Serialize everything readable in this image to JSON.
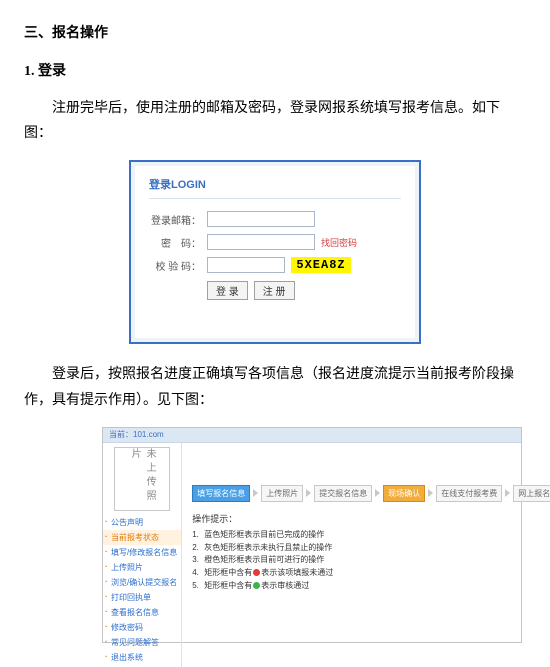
{
  "doc": {
    "heading_section": "三、报名操作",
    "heading_sub": "1. 登录",
    "para1": "注册完毕后，使用注册的邮箱及密码，登录网报系统填写报考信息。如下图：",
    "para2": "登录后，按照报名进度正确填写各项信息（报名进度流提示当前报考阶段操作，具有提示作用）。见下图："
  },
  "login": {
    "title": "登录LOGIN",
    "label_email": "登录邮箱：",
    "label_pwd": "密　码：",
    "label_captcha": "校 验 码：",
    "find_pwd": "找回密码",
    "captcha": "5XEA8Z",
    "btn_login": "登 录",
    "btn_reg": "注 册"
  },
  "progress": {
    "topbar": "当前：101.com",
    "photo_slot": "未上传照片",
    "side_items": [
      {
        "label": "公告声明",
        "cls": "blue"
      },
      {
        "label": "当前报考状态",
        "cls": "orange"
      },
      {
        "label": "填写/修改报名信息",
        "cls": "blue"
      },
      {
        "label": "上传照片",
        "cls": "blue"
      },
      {
        "label": "浏览/确认提交报名",
        "cls": "blue"
      },
      {
        "label": "打印回执单",
        "cls": "blue"
      },
      {
        "label": "查看报名信息",
        "cls": "blue"
      },
      {
        "label": "修改密码",
        "cls": "blue"
      },
      {
        "label": "常见问题解答",
        "cls": "blue"
      },
      {
        "label": "退出系统",
        "cls": "blue"
      }
    ],
    "flow_steps": [
      {
        "label": "填写报名信息",
        "state": "done"
      },
      {
        "label": "上传照片",
        "state": ""
      },
      {
        "label": "提交报名信息",
        "state": ""
      },
      {
        "label": "现场确认",
        "state": "current"
      },
      {
        "label": "在线支付报考费",
        "state": ""
      },
      {
        "label": "网上报名完成",
        "state": ""
      }
    ],
    "tips_title": "操作提示：",
    "tips": [
      "蓝色矩形框表示目前已完成的操作",
      "灰色矩形框表示未执行且禁止的操作",
      "橙色矩形框表示目前可进行的操作",
      "矩形框中含有●表示该项填报未通过",
      "矩形框中含有●表示审核通过"
    ]
  }
}
